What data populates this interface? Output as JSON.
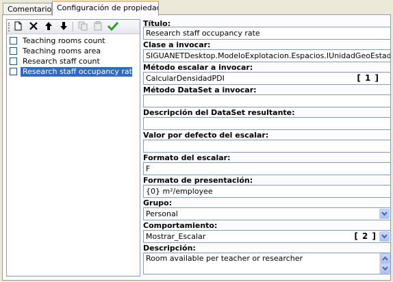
{
  "tabs": [
    {
      "label": "Comentarios"
    },
    {
      "label": "Configuración de propiedades"
    }
  ],
  "toolbar": {
    "buttons": [
      "new-document-icon",
      "delete-icon",
      "arrow-up-icon",
      "arrow-down-icon",
      "copy-icon",
      "paste-icon",
      "checkmark-icon"
    ],
    "accent_check": "#2f9b2f"
  },
  "list": {
    "items": [
      {
        "label": "Teaching rooms count",
        "checked": false
      },
      {
        "label": "Teaching rooms area",
        "checked": false
      },
      {
        "label": "Research staff count",
        "checked": false
      },
      {
        "label": "Research staff occupancy rate",
        "checked": false
      }
    ],
    "selected_color": "#316ac5"
  },
  "form": {
    "titulo": {
      "label": "Título:",
      "value": "Research staff occupancy rate"
    },
    "clase": {
      "label": "Clase a invocar:",
      "value": "SIGUANETDesktop.ModeloExplotacion.Espacios.IUnidadGeoEstadistica"
    },
    "metodo_escalar": {
      "label": "Método escalar a invocar:",
      "value": "CalcularDensidadPDI",
      "marker": "[ 1 ]"
    },
    "metodo_dataset": {
      "label": "Método DataSet a invocar:",
      "value": ""
    },
    "descripcion_dataset": {
      "label": "Descripción del DataSet resultante:",
      "value": ""
    },
    "valor_defecto": {
      "label": "Valor por defecto del escalar:",
      "value": ""
    },
    "formato_escalar": {
      "label": "Formato del escalar:",
      "value": "F"
    },
    "formato_presentacion": {
      "label": "Formato de presentación:",
      "value": "{0} m²/employee"
    },
    "grupo": {
      "label": "Grupo:",
      "value": "Personal"
    },
    "comportamiento": {
      "label": "Comportamiento:",
      "value": "Mostrar_Escalar",
      "marker": "[ 2 ]"
    },
    "descripcion": {
      "label": "Descripción:",
      "value": "Room available per teacher or researcher"
    }
  }
}
